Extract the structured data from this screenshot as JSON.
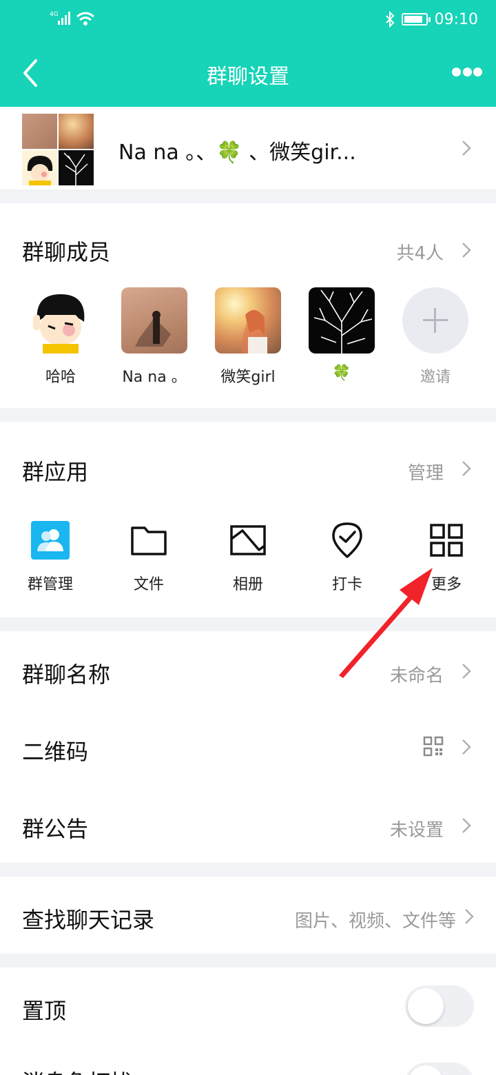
{
  "status": {
    "network": "4G",
    "time": "09:10"
  },
  "nav": {
    "title": "群聊设置"
  },
  "group": {
    "name": "Na  na 。、🍀 、微笑gir..."
  },
  "members": {
    "title": "群聊成员",
    "count": "共4人",
    "list": [
      {
        "name": "哈哈"
      },
      {
        "name": "Na  na 。"
      },
      {
        "name": "微笑girl"
      },
      {
        "name": "🍀"
      }
    ],
    "invite_label": "邀请"
  },
  "apps": {
    "title": "群应用",
    "manage": "管理",
    "items": [
      {
        "label": "群管理",
        "icon": "group-admin-icon"
      },
      {
        "label": "文件",
        "icon": "folder-icon"
      },
      {
        "label": "相册",
        "icon": "album-icon"
      },
      {
        "label": "打卡",
        "icon": "check-in-icon"
      },
      {
        "label": "更多",
        "icon": "grid-icon"
      }
    ]
  },
  "settings": {
    "name": {
      "label": "群聊名称",
      "value": "未命名"
    },
    "qr": {
      "label": "二维码",
      "icon": "qr-code-icon"
    },
    "notice": {
      "label": "群公告",
      "value": "未设置"
    }
  },
  "search": {
    "label": "查找聊天记录",
    "value": "图片、视频、文件等"
  },
  "toggles": {
    "pin": {
      "label": "置顶",
      "on": false
    },
    "dnd": {
      "label": "消息免打扰",
      "on": false
    }
  },
  "colors": {
    "primary": "#17d3b7",
    "arrow": "#f0222a",
    "app_icon_blue": "#19b6f0"
  }
}
